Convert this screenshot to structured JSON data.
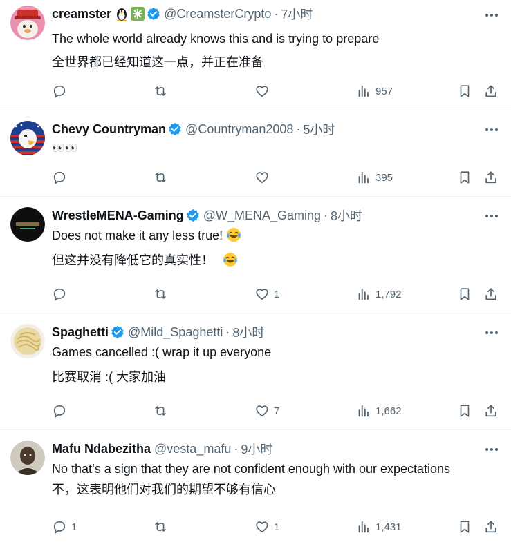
{
  "tweets": [
    {
      "name": "creamster",
      "handle": "@CreamsterCrypto",
      "time": "7小时",
      "lines": [
        "The whole world already knows this and is trying to prepare",
        "全世界都已经知道这一点，并正在准备"
      ],
      "reply": "",
      "retweet": "",
      "like": "",
      "views": "957"
    },
    {
      "name": "Chevy Countryman",
      "handle": "@Countryman2008",
      "time": "5小时",
      "lines": [
        "👀👀"
      ],
      "reply": "",
      "retweet": "",
      "like": "",
      "views": "395"
    },
    {
      "name": "WrestleMENA-Gaming",
      "handle": "@W_MENA_Gaming",
      "time": "8小时",
      "lines": [
        "Does not make it any less true!",
        "但这并没有降低它的真实性！"
      ],
      "reply": "",
      "retweet": "",
      "like": "1",
      "views": "1,792"
    },
    {
      "name": "Spaghetti",
      "handle": "@Mild_Spaghetti",
      "time": "8小时",
      "lines": [
        "Games cancelled :( wrap it up everyone",
        "比赛取消 :( 大家加油"
      ],
      "reply": "",
      "retweet": "",
      "like": "7",
      "views": "1,662"
    },
    {
      "name": "Mafu Ndabezitha",
      "handle": "@vesta_mafu",
      "time": "9小时",
      "lines": [
        "No that’s a sign that they are not confident enough with our expectations",
        "不，这表明他们对我们的期望不够有信心"
      ],
      "reply": "1",
      "retweet": "",
      "like": "1",
      "views": "1,431"
    }
  ],
  "separator": "·",
  "colors": {
    "verified": "#1d9bf0",
    "secondary_text": "#536471",
    "primary_text": "#0f1419"
  }
}
